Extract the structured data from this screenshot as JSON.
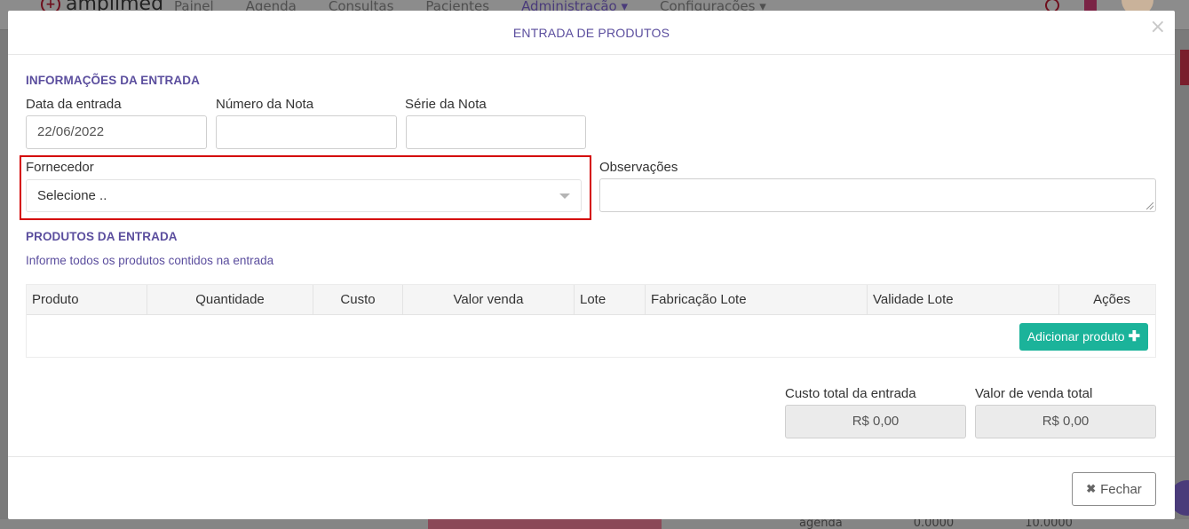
{
  "background": {
    "logo_text": "amplimed",
    "logo_symbol": "+",
    "menu": [
      "Painel",
      "Agenda",
      "Consultas",
      "Pacientes",
      "Administração ▾",
      "Configurações ▾"
    ],
    "bottom_texts": [
      "agenda",
      "0.0000",
      "10.0000"
    ]
  },
  "modal": {
    "title": "ENTRADA DE PRODUTOS",
    "close_symbol": "×",
    "entry_info": {
      "section_title": "INFORMAÇÕES DA ENTRADA",
      "date_label": "Data da entrada",
      "date_value": "22/06/2022",
      "invoice_number_label": "Número da Nota",
      "invoice_number_value": "",
      "invoice_series_label": "Série da Nota",
      "invoice_series_value": "",
      "supplier_label": "Fornecedor",
      "supplier_value": "Selecione ..",
      "notes_label": "Observações",
      "notes_value": ""
    },
    "products": {
      "section_title": "PRODUTOS DA ENTRADA",
      "hint": "Informe todos os produtos contidos na entrada",
      "columns": [
        "Produto",
        "Quantidade",
        "Custo",
        "Valor venda",
        "Lote",
        "Fabricação Lote",
        "Validade Lote",
        "Ações"
      ],
      "add_button_label": "Adicionar produto",
      "add_button_icon": "plus-icon"
    },
    "totals": {
      "cost_label": "Custo total da entrada",
      "cost_value": "R$ 0,00",
      "sale_label": "Valor de venda total",
      "sale_value": "R$ 0,00"
    },
    "footer": {
      "close_label": "Fechar",
      "close_icon": "✖"
    }
  },
  "colors": {
    "accent_purple": "#5b4e9e",
    "button_teal": "#1bb39a",
    "highlight_red": "#d40000"
  }
}
